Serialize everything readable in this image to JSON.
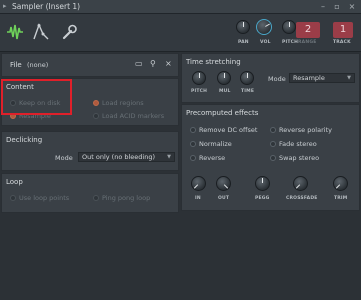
{
  "window": {
    "title": "Sampler (Insert 1)"
  },
  "toolbar": {
    "knobs": [
      {
        "label": "PAN"
      },
      {
        "label": "VOL"
      },
      {
        "label": "PITCH"
      },
      {
        "label": "RANGE"
      }
    ],
    "pitch_value": "2",
    "track_label": "TRACK",
    "track_value": "1"
  },
  "file": {
    "label": "File",
    "value": "(none)"
  },
  "content": {
    "title": "Content",
    "options": [
      {
        "label": "Keep on disk"
      },
      {
        "label": "Resample"
      },
      {
        "label": "Load regions"
      },
      {
        "label": "Load ACID markers"
      }
    ]
  },
  "declicking": {
    "title": "Declicking",
    "mode_label": "Mode",
    "mode_value": "Out only (no bleeding)"
  },
  "loop": {
    "title": "Loop",
    "options": [
      {
        "label": "Use loop points"
      },
      {
        "label": "Ping pong loop"
      }
    ]
  },
  "time_stretching": {
    "title": "Time stretching",
    "knobs": [
      {
        "label": "PITCH"
      },
      {
        "label": "MUL"
      },
      {
        "label": "TIME"
      }
    ],
    "mode_label": "Mode",
    "mode_value": "Resample"
  },
  "precomputed": {
    "title": "Precomputed effects",
    "options": [
      {
        "label": "Remove DC offset"
      },
      {
        "label": "Reverse polarity"
      },
      {
        "label": "Normalize"
      },
      {
        "label": "Fade stereo"
      },
      {
        "label": "Reverse"
      },
      {
        "label": "Swap stereo"
      }
    ],
    "knobs": [
      {
        "label": "IN"
      },
      {
        "label": "OUT"
      },
      {
        "label": "PEGG"
      },
      {
        "label": "CROSSFADE"
      },
      {
        "label": "TRIM"
      }
    ]
  },
  "colors": {
    "accent_green": "#6fd15a",
    "accent_red": "#9b3d48",
    "highlight": "#e0202a"
  }
}
